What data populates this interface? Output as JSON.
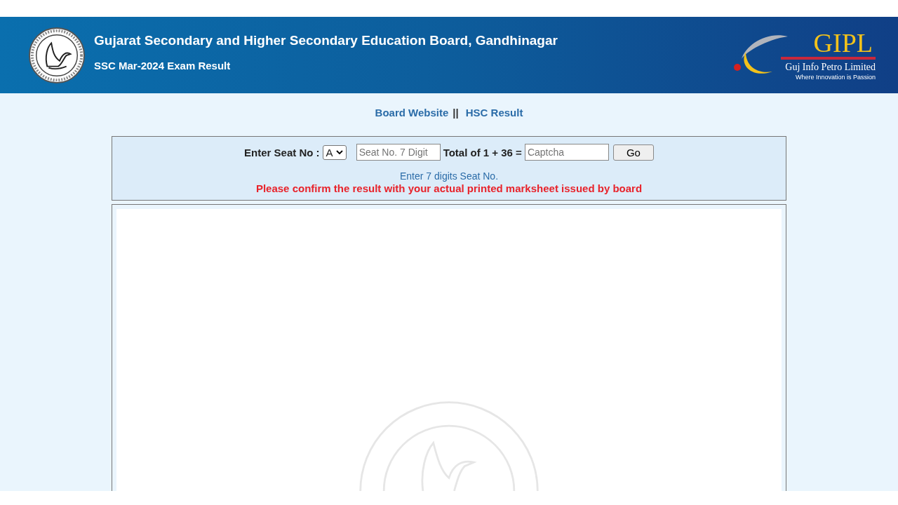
{
  "header": {
    "title": "Gujarat Secondary and Higher Secondary Education Board, Gandhinagar",
    "subtitle": "SSC Mar-2024 Exam Result",
    "partner_logo": {
      "name": "GIPL",
      "company": "Guj Info Petro Limited",
      "tagline": "Where Innovation is Passion"
    }
  },
  "links": [
    {
      "label": "Board Website"
    },
    {
      "label": "HSC Result"
    }
  ],
  "link_separator": "||",
  "form": {
    "seat_label": "Enter Seat No :",
    "series_select": {
      "value": "A"
    },
    "seat_field": {
      "placeholder": "Seat No. 7 Digit"
    },
    "captcha_label": "Total of 1 + 36 =",
    "captcha_field": {
      "placeholder": "Captcha"
    },
    "submit": "Go",
    "hint": "Enter 7 digits Seat No.",
    "warning": "Please confirm the result with your actual printed marksheet issued by board"
  }
}
